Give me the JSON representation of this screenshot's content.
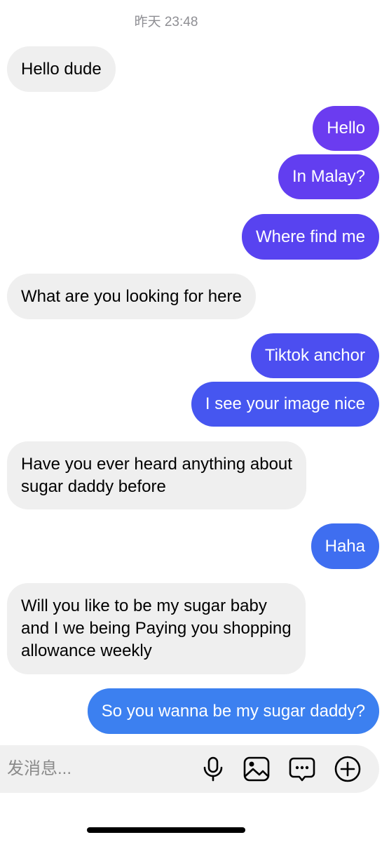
{
  "conversation": {
    "timestamp": "昨天 23:48",
    "messages": [
      {
        "from": "them",
        "text": "Hello dude"
      },
      {
        "from": "me",
        "text": "Hello"
      },
      {
        "from": "me",
        "text": "In Malay?"
      },
      {
        "from": "me",
        "text": "Where find me"
      },
      {
        "from": "them",
        "text": "What are you looking for here"
      },
      {
        "from": "me",
        "text": "Tiktok anchor"
      },
      {
        "from": "me",
        "text": "I see your image nice"
      },
      {
        "from": "them",
        "lines": [
          "Have you ever heard anything about",
          "sugar daddy before"
        ]
      },
      {
        "from": "me",
        "text": "Haha"
      },
      {
        "from": "them",
        "lines": [
          "Will you like to be my sugar baby",
          "and I we being Paying you shopping",
          "allowance weekly"
        ]
      },
      {
        "from": "me",
        "text": "So you wanna be my sugar daddy?"
      }
    ]
  },
  "composer": {
    "placeholder": "发消息...",
    "icons": [
      "microphone-icon",
      "image-icon",
      "chat-bubble-icon",
      "add-circle-icon"
    ]
  },
  "colors": {
    "incoming_bubble": "#efefef",
    "outgoing_gradient": [
      "#6a3cf0",
      "#4e4ef0",
      "#3f6cf0",
      "#3d7ff0"
    ]
  }
}
